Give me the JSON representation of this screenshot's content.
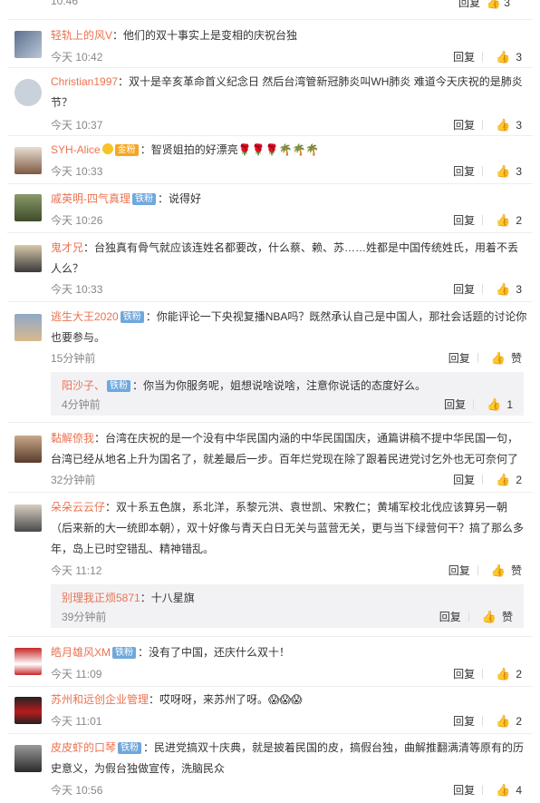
{
  "top": {
    "time": "10:46",
    "reply": "回复",
    "likes": "3"
  },
  "labels": {
    "reply": "回复",
    "like_zero": "赞",
    "badge_iron": "铁粉",
    "badge_gold": "金粉"
  },
  "comments": [
    {
      "user": "轻轨上的风V",
      "text": "：他们的双十事实上是变相的庆祝台独",
      "time": "今天 10:42",
      "likes": "3"
    },
    {
      "user": "Christian1997",
      "text": "：双十是辛亥革命首义纪念日 然后台湾管新冠肺炎叫WH肺炎 难道今天庆祝的是肺炎节？",
      "time": "今天 10:37",
      "likes": "3"
    },
    {
      "user": "SYH-Alice",
      "text": "：智贤姐拍的好漂亮🌹🌹🌹🌴🌴🌴",
      "time": "今天 10:33",
      "likes": "3"
    },
    {
      "user": "戚英明-四气真理",
      "text": "：说得好",
      "time": "今天 10:26",
      "likes": "2"
    },
    {
      "user": "鬼才兄",
      "text": "：台独真有骨气就应该连姓名都要改，什么蔡、赖、苏……姓都是中国传统姓氏，用着不丢人么？",
      "time": "今天 10:33",
      "likes": "3"
    },
    {
      "user": "逃生大王2020",
      "text": "：你能评论一下央视复播NBA吗？既然承认自己是中国人，那社会话题的讨论你也要参与。",
      "time": "15分钟前",
      "likes": "赞",
      "reply": {
        "user": "阳沙子、",
        "text": "：你当为你服务呢，姐想说啥说啥，注意你说话的态度好么。",
        "time": "4分钟前",
        "likes": "1"
      }
    },
    {
      "user": "黏解倷我",
      "text": "：台湾在庆祝的是一个没有中华民国内涵的中华民国国庆，通篇讲稿不提中华民国一句，台湾已经从地名上升为国名了，就差最后一步。百年烂党现在除了跟着民进党讨乞外也无可奈何了",
      "time": "32分钟前",
      "likes": "2"
    },
    {
      "user": "朵朵云云仔",
      "text": "：双十系五色旗，系北洋，系黎元洪、袁世凯、宋教仁；黄埔军校北伐应该算另一朝（后来新的大一统即本朝），双十好像与青天白日无关与蓝营无关，更与当下绿营何干？搞了那么多年，岛上已时空错乱、精神错乱。",
      "time": "今天 11:12",
      "likes": "赞",
      "reply": {
        "user": "别理我正烦5871",
        "text": "：十八星旗",
        "time": "39分钟前",
        "likes": "赞"
      }
    },
    {
      "user": "皓月雄风XM",
      "text": "：没有了中国，还庆什么双十！",
      "time": "今天 11:09",
      "likes": "2"
    },
    {
      "user": "苏州和远创企业管理",
      "text": "：哎呀呀，来苏州了呀。😱😱😱",
      "time": "今天 11:01",
      "likes": "2"
    },
    {
      "user": "皮皮虾的口琴",
      "text": "：民进党搞双十庆典，就是披着民国的皮，搞假台独，曲解推翻满清等原有的历史意义，为假台独做宣传，洗脑民众",
      "time": "今天 10:56",
      "likes": "4"
    }
  ],
  "colors": {
    "username": "#eb7350",
    "badge": "#6fa8dc",
    "meta": "#888888"
  }
}
